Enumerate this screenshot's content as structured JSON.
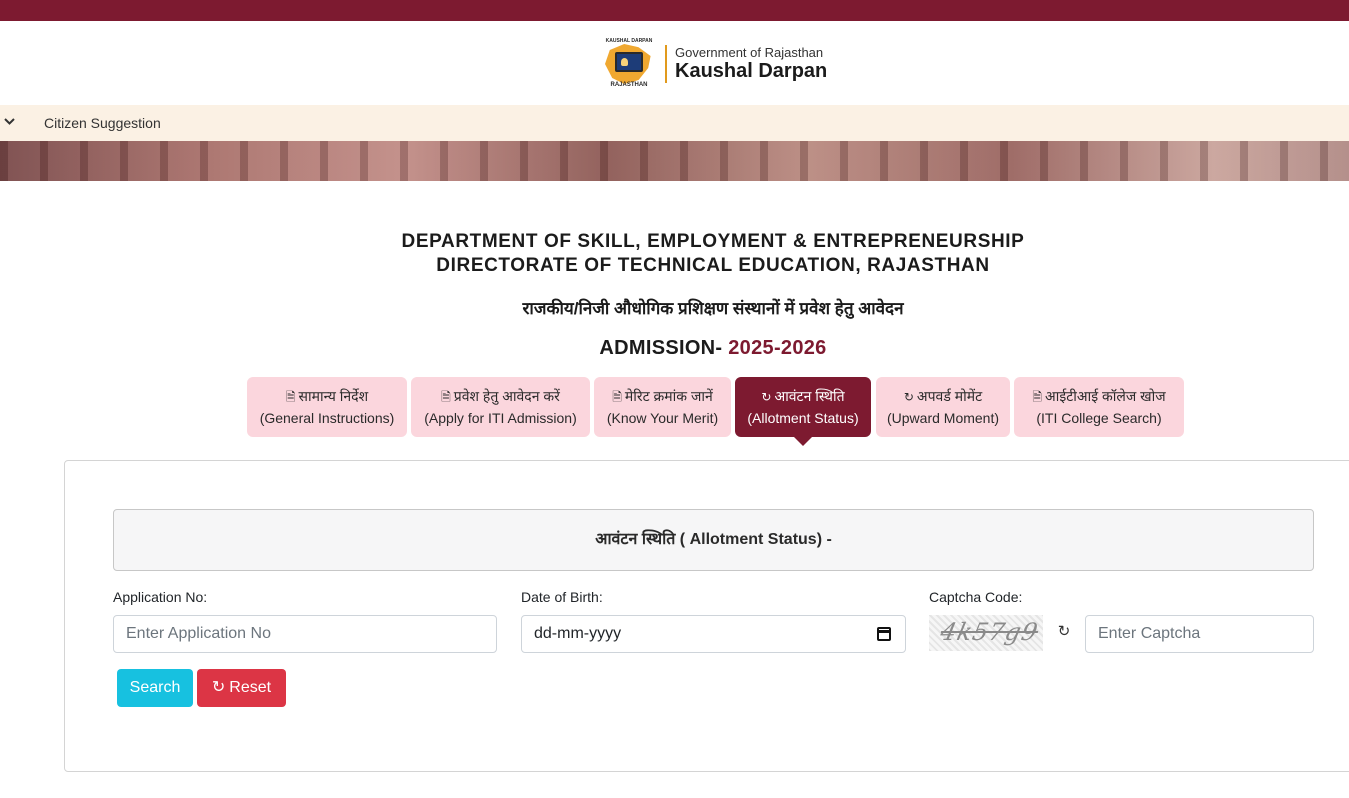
{
  "brand": {
    "emblem_top": "KAUSHAL DARPAN",
    "emblem_bottom": "RAJASTHAN",
    "gov": "Government of Rajasthan",
    "name": "Kaushal Darpan"
  },
  "nav": {
    "items": [
      {
        "label": "Citizen Suggestion"
      }
    ]
  },
  "header": {
    "dept_line1": "DEPARTMENT OF SKILL, EMPLOYMENT & ENTREPRENEURSHIP",
    "dept_line2": "DIRECTORATE OF TECHNICAL EDUCATION, RAJASTHAN",
    "hindi_title": "राजकीय/निजी औधोगिक प्रशिक्षण संस्थानों में प्रवेश हेतु आवेदन",
    "admission_label": "ADMISSION- ",
    "admission_year": "2025-2026"
  },
  "tabs": [
    {
      "hindi": "सामान्य निर्देश",
      "english": "(General Instructions)",
      "icon": "document-icon",
      "active": false
    },
    {
      "hindi": "प्रवेश हेतु आवेदन करें",
      "english": "(Apply for ITI Admission)",
      "icon": "document-icon",
      "active": false
    },
    {
      "hindi": "मेरिट क्रमांक जानें",
      "english": "(Know Your Merit)",
      "icon": "document-icon",
      "active": false
    },
    {
      "hindi": "आवंटन स्थिति",
      "english": "(Allotment Status)",
      "icon": "refresh-icon",
      "active": true
    },
    {
      "hindi": "अपवर्ड मोमेंट",
      "english": "(Upward Moment)",
      "icon": "refresh-icon",
      "active": false
    },
    {
      "hindi": "आईटीआई कॉलेज खोज",
      "english": "(ITI College Search)",
      "icon": "document-icon",
      "active": false
    }
  ],
  "form": {
    "title": "आवंटन स्थिति ( Allotment Status) -",
    "application_label": "Application No:",
    "application_placeholder": "Enter Application No",
    "dob_label": "Date of Birth:",
    "dob_value": "dd-mm-yyyy",
    "captcha_label": "Captcha Code:",
    "captcha_text": "4k57g9",
    "captcha_placeholder": "Enter Captcha",
    "search_label": "Search",
    "reset_label": "Reset"
  },
  "colors": {
    "brand_maroon": "#7d1a30",
    "tab_pink": "#fbd6dd",
    "nav_cream": "#fbf1e4",
    "search_button": "#17c1e0",
    "reset_button": "#dc3545"
  }
}
